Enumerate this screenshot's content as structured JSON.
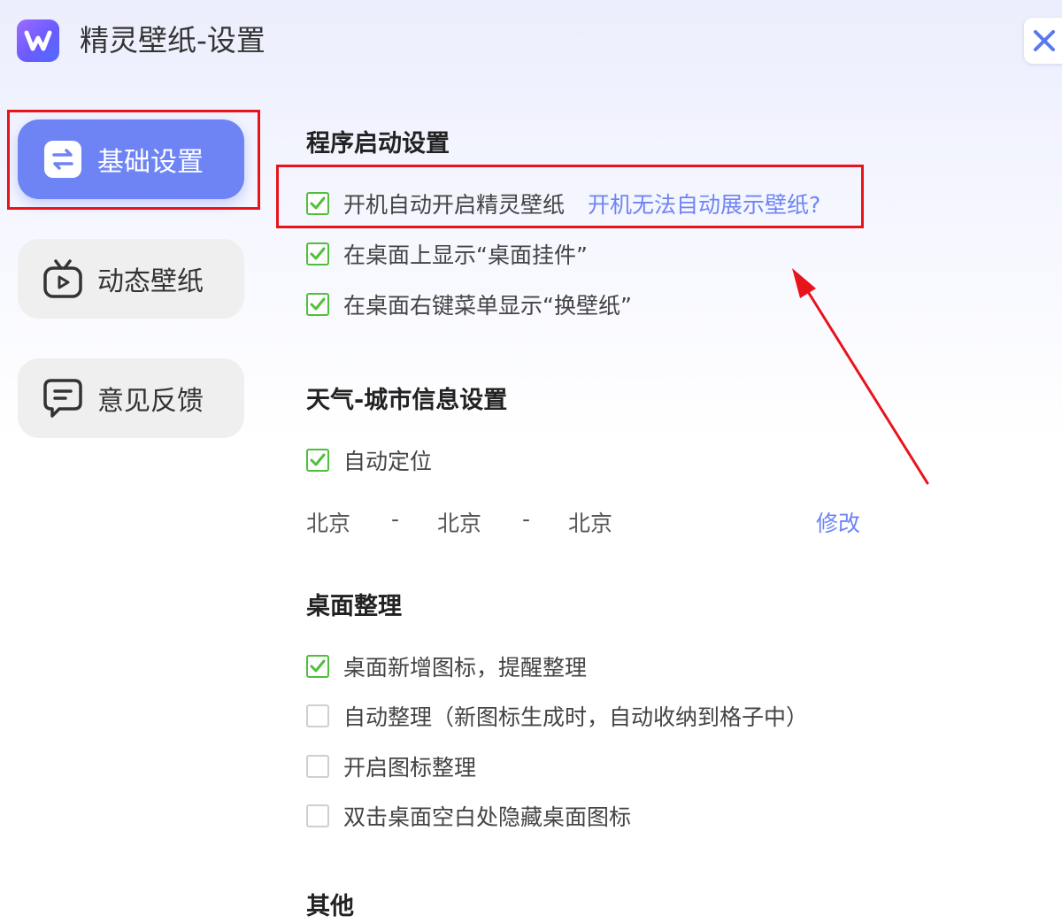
{
  "window": {
    "title": "精灵壁纸-设置",
    "logo_icon": "app-logo-w-icon",
    "close_icon": "close-icon"
  },
  "sidebar": {
    "items": [
      {
        "label": "基础设置",
        "icon": "toggle-sliders-icon",
        "active": true
      },
      {
        "label": "动态壁纸",
        "icon": "tv-play-icon",
        "active": false
      },
      {
        "label": "意见反馈",
        "icon": "chat-bubble-icon",
        "active": false
      }
    ]
  },
  "startup": {
    "title": "程序启动设置",
    "options": [
      {
        "label": "开机自动开启精灵壁纸",
        "checked": true
      },
      {
        "label": "在桌面上显示“桌面挂件”",
        "checked": true
      },
      {
        "label": "在桌面右键菜单显示“换壁纸”",
        "checked": true
      }
    ],
    "help_link": "开机无法自动展示壁纸?"
  },
  "weather": {
    "title": "天气-城市信息设置",
    "auto_locate": {
      "label": "自动定位",
      "checked": true
    },
    "province": "北京",
    "city": "北京",
    "district": "北京",
    "separator": "-",
    "modify_link": "修改"
  },
  "desktop": {
    "title": "桌面整理",
    "options": [
      {
        "label": "桌面新增图标，提醒整理",
        "checked": true
      },
      {
        "label": "自动整理（新图标生成时，自动收纳到格子中）",
        "checked": false
      },
      {
        "label": "开启图标整理",
        "checked": false
      },
      {
        "label": "双击桌面空白处隐藏桌面图标",
        "checked": false
      }
    ]
  },
  "other": {
    "title": "其他"
  },
  "colors": {
    "accent": "#6e84f5",
    "check_green": "#4fbf3c",
    "highlight_red": "#e8141b"
  }
}
